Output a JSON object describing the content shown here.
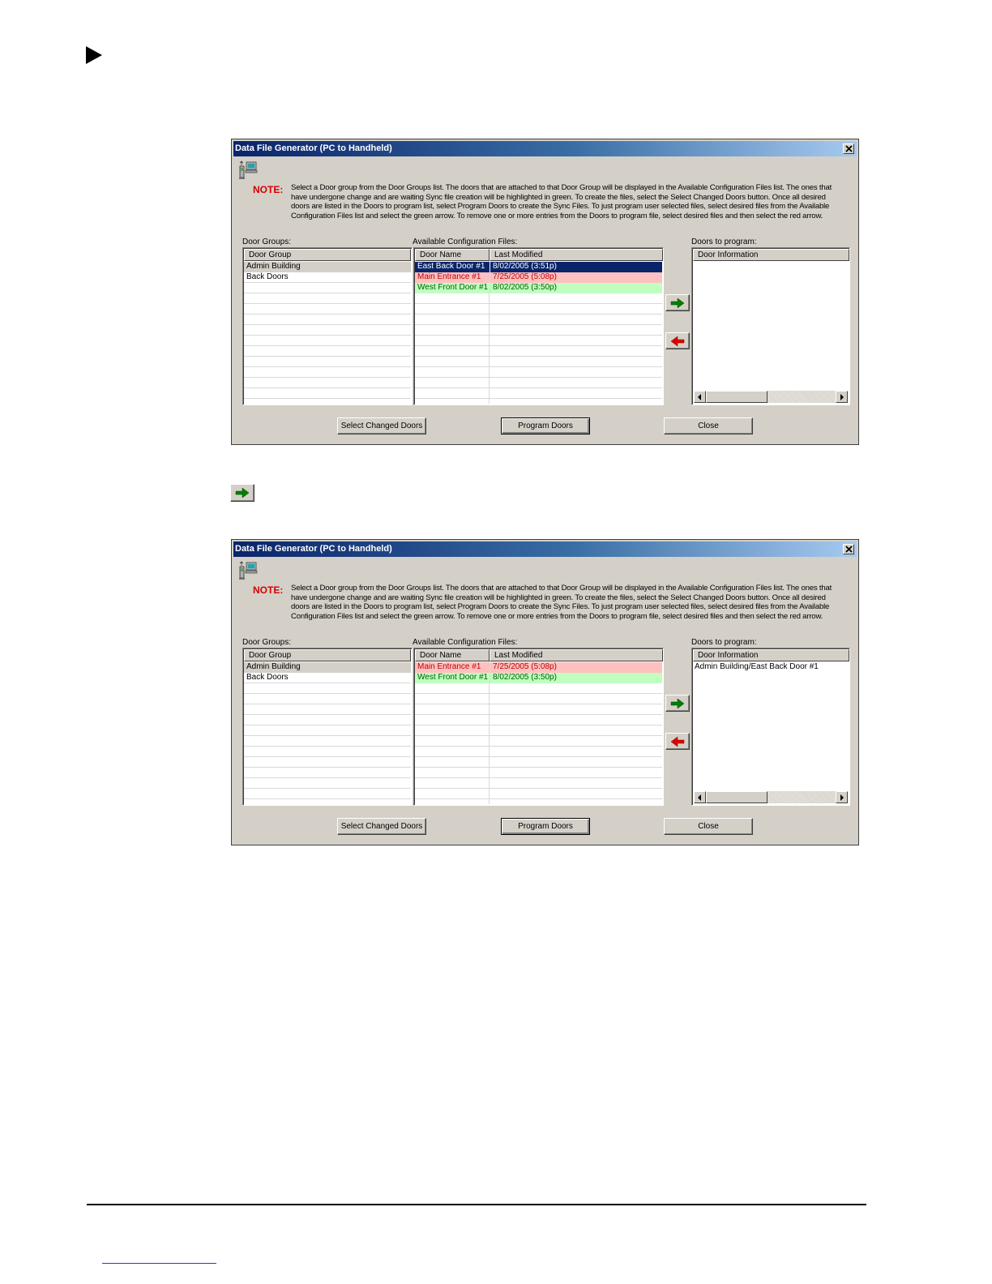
{
  "dialogs": [
    {
      "title": "Data File Generator (PC to Handheld)",
      "note_label": "NOTE:",
      "note_text": "Select a Door group from the Door Groups list. The doors that are attached to that Door Group will be displayed in the Available Configuration Files list. The ones that have undergone change and are waiting Sync file creation will be highlighted in green. To create the files, select the Select Changed Doors button. Once all desired doors are listed in the Doors to program list, select Program Doors to create the Sync Files. To just program user selected files, select desired files from the Available Configuration Files list and select the green arrow. To remove one or more entries from the Doors to program file, select desired files and then select the red arrow.",
      "door_groups_label": "Door Groups:",
      "door_group_header": "Door Group",
      "door_groups": [
        {
          "name": "Admin Building",
          "state": "selected"
        },
        {
          "name": "Back Doors",
          "state": "normal"
        }
      ],
      "config_label": "Available Configuration Files:",
      "config_headers": [
        "Door Name",
        "Last Modified"
      ],
      "config_files": [
        {
          "name": "East Back Door #1",
          "modified": "8/02/2005 (3:51p)",
          "state": "selected"
        },
        {
          "name": "Main Entrance #1",
          "modified": "7/25/2005 (5:08p)",
          "state": "pink"
        },
        {
          "name": "West Front Door #1",
          "modified": "8/02/2005 (3:50p)",
          "state": "green"
        }
      ],
      "program_label": "Doors to program:",
      "program_header": "Door Information",
      "program_items": [],
      "buttons": {
        "select_changed": "Select Changed Doors",
        "program": "Program Doors",
        "close": "Close"
      }
    },
    {
      "title": "Data File Generator (PC to Handheld)",
      "note_label": "NOTE:",
      "note_text": "Select a Door group from the Door Groups list. The doors that are attached to that Door Group will be displayed in the Available Configuration Files list. The ones that have undergone change and are waiting Sync file creation will be highlighted in green. To create the files, select the Select Changed Doors button. Once all desired doors are listed in the Doors to program list, select Program Doors to create the Sync Files. To just program user selected files, select desired files from the Available Configuration Files list and select the green arrow. To remove one or more entries from the Doors to program file, select desired files and then select the red arrow.",
      "door_groups_label": "Door Groups:",
      "door_group_header": "Door Group",
      "door_groups": [
        {
          "name": "Admin Building",
          "state": "selected"
        },
        {
          "name": "Back Doors",
          "state": "normal"
        }
      ],
      "config_label": "Available Configuration Files:",
      "config_headers": [
        "Door Name",
        "Last Modified"
      ],
      "config_files": [
        {
          "name": "Main Entrance #1",
          "modified": "7/25/2005 (5:08p)",
          "state": "pink"
        },
        {
          "name": "West Front Door #1",
          "modified": "8/02/2005 (3:50p)",
          "state": "green"
        }
      ],
      "program_label": "Doors to program:",
      "program_header": "Door Information",
      "program_items": [
        "Admin Building/East Back Door #1"
      ],
      "buttons": {
        "select_changed": "Select Changed Doors",
        "program": "Program Doors",
        "close": "Close"
      }
    }
  ],
  "colors": {
    "selected_bg": "#0a246a",
    "selected_fg": "#ffffff",
    "group_selected_bg": "#d4d0c8",
    "pink_bg": "#ffc0c0",
    "pink_fg": "#c00000",
    "green_bg": "#c0ffc0",
    "green_fg": "#006000",
    "add_arrow": "#008000",
    "remove_arrow": "#e00000"
  },
  "icons": {
    "bullet": "right-triangle-icon",
    "add": "green-right-arrow-icon",
    "remove": "red-left-arrow-icon",
    "app": "handheld-pc-icon",
    "close": "close-icon"
  }
}
